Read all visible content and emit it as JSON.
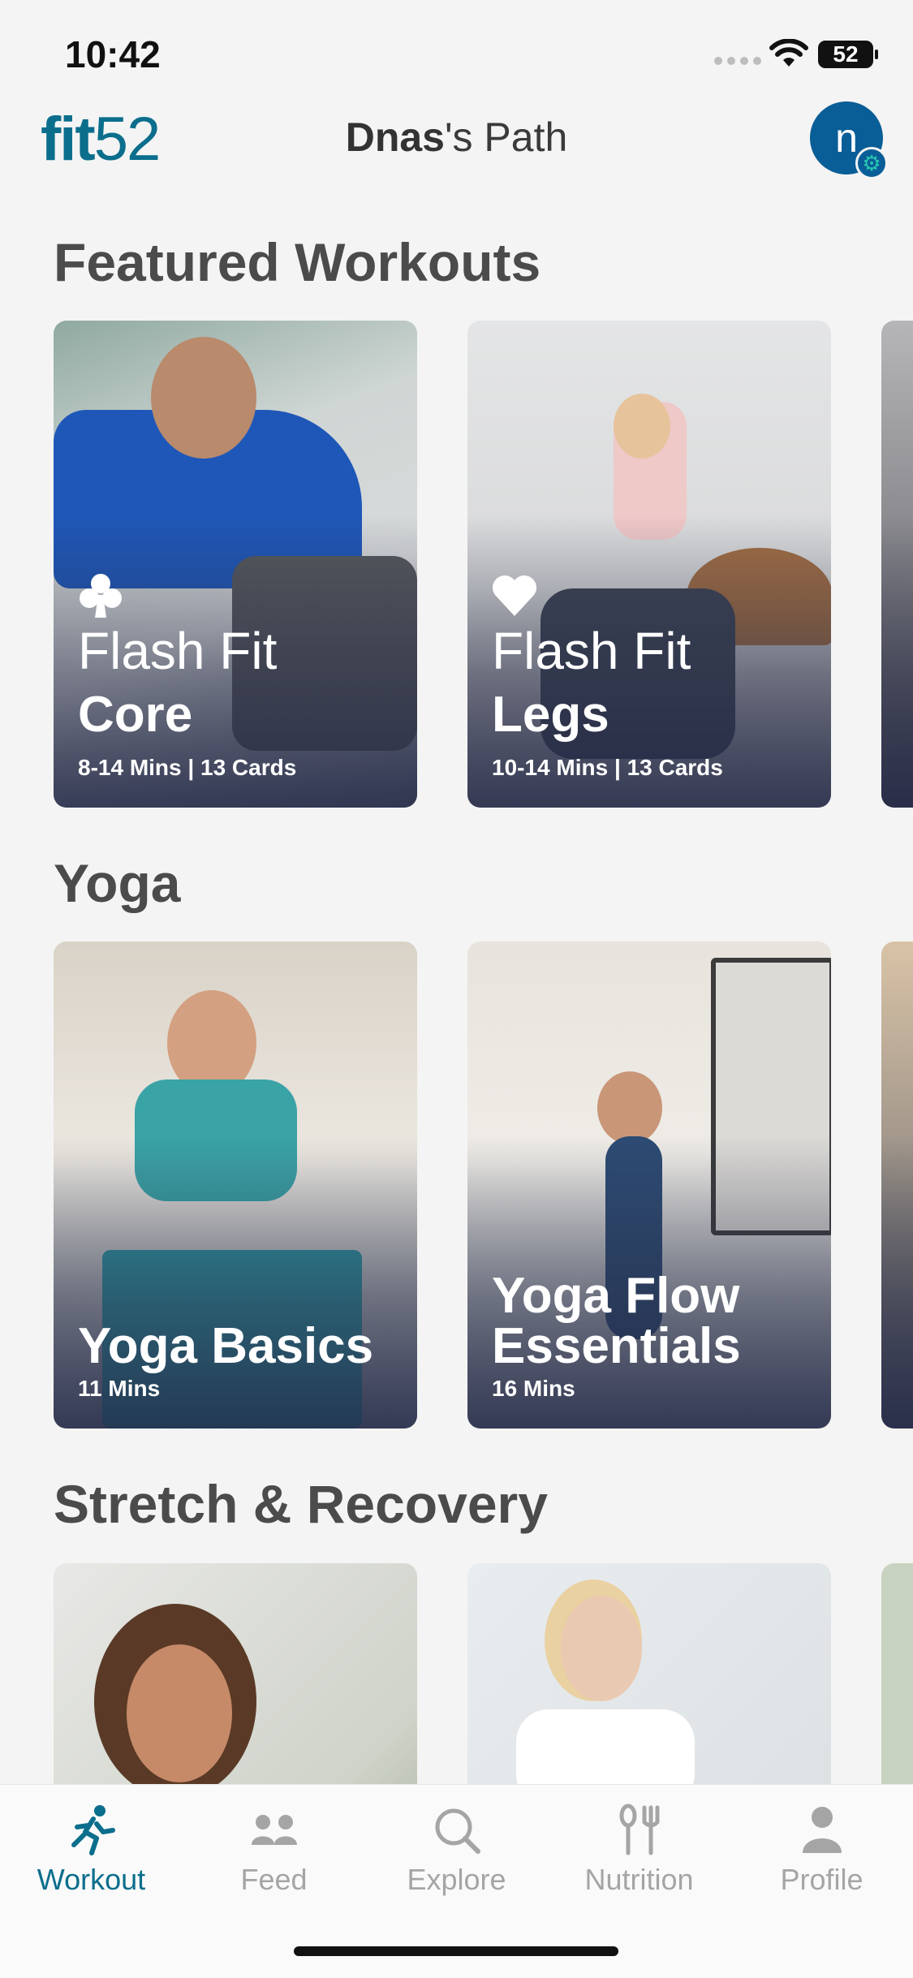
{
  "status_bar": {
    "time": "10:42",
    "battery": "52"
  },
  "header": {
    "logo_fit": "fit",
    "logo_num": "52",
    "title_name": "Dnas",
    "title_rest": "'s Path",
    "avatar_initial": "n"
  },
  "sections": [
    {
      "title": "Featured Workouts",
      "cards": [
        {
          "line1": "Flash Fit",
          "line2": "Core",
          "meta": "8-14 Mins | 13 Cards",
          "suit": "club-icon"
        },
        {
          "line1": "Flash Fit",
          "line2": "Legs",
          "meta": "10-14 Mins | 13 Cards",
          "suit": "heart-icon"
        }
      ]
    },
    {
      "title": "Yoga",
      "cards": [
        {
          "title_lines": [
            "Yoga Basics"
          ],
          "meta": "11 Mins"
        },
        {
          "title_lines": [
            "Yoga Flow",
            "Essentials"
          ],
          "meta": "16 Mins"
        }
      ]
    },
    {
      "title": "Stretch & Recovery"
    }
  ],
  "tabs": [
    {
      "label": "Workout",
      "icon": "runner-icon",
      "active": true
    },
    {
      "label": "Feed",
      "icon": "group-icon",
      "active": false
    },
    {
      "label": "Explore",
      "icon": "search-icon",
      "active": false
    },
    {
      "label": "Nutrition",
      "icon": "utensils-icon",
      "active": false
    },
    {
      "label": "Profile",
      "icon": "person-icon",
      "active": false
    }
  ],
  "colors": {
    "brand": "#0b6e8c",
    "avatar": "#0a5e97",
    "inactive": "#a5a5a5"
  }
}
